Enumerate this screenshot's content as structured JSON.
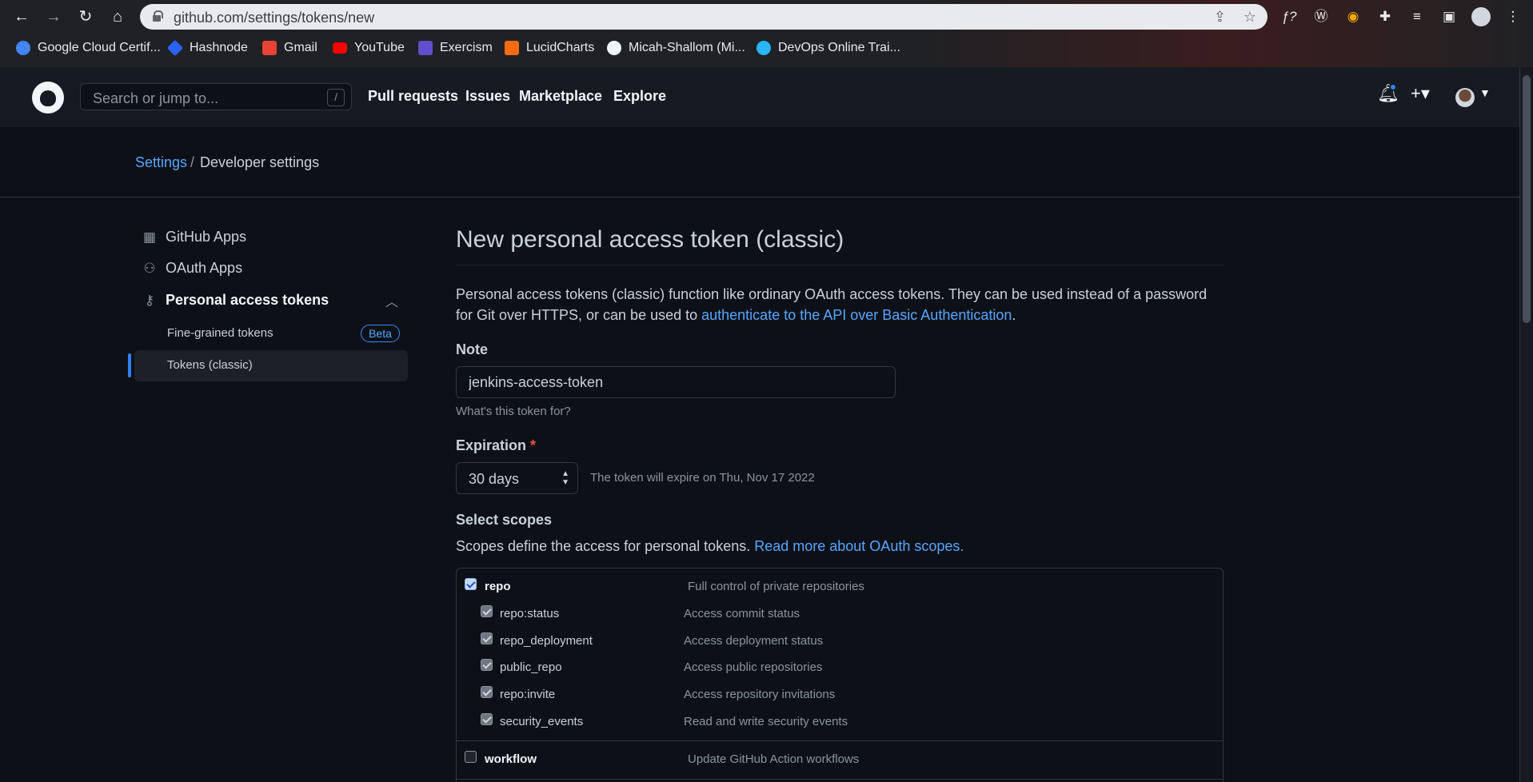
{
  "browser": {
    "url": "github.com/settings/tokens/new",
    "bookmarks": [
      {
        "label": "Google Cloud Certif...",
        "color": "#4285f4"
      },
      {
        "label": "Hashnode",
        "color": "#2962ff"
      },
      {
        "label": "Gmail",
        "color": "#ea4335"
      },
      {
        "label": "YouTube",
        "color": "#ff0000"
      },
      {
        "label": "Exercism",
        "color": "#604fcd"
      },
      {
        "label": "LucidCharts",
        "color": "#f96b13"
      },
      {
        "label": "Micah-Shallom (Mi...",
        "color": "#f0f6fc"
      },
      {
        "label": "DevOps Online Trai...",
        "color": "#29b6f6"
      }
    ]
  },
  "header": {
    "search_placeholder": "Search or jump to...",
    "search_shortcut": "/",
    "nav": [
      "Pull requests",
      "Issues",
      "Marketplace",
      "Explore"
    ]
  },
  "breadcrumb": {
    "settings": "Settings",
    "separator": "/",
    "current": "Developer settings"
  },
  "sidebar": {
    "github_apps": "GitHub Apps",
    "oauth_apps": "OAuth Apps",
    "personal_tokens": "Personal access tokens",
    "fine_grained": "Fine-grained tokens",
    "beta": "Beta",
    "classic": "Tokens (classic)"
  },
  "main": {
    "title": "New personal access token (classic)",
    "desc_1": "Personal access tokens (classic) function like ordinary OAuth access tokens. They can be used instead of a password for Git over HTTPS, or can be used to ",
    "desc_link": "authenticate to the API over Basic Authentication",
    "desc_end": ".",
    "note_label": "Note",
    "note_value": "jenkins-access-token",
    "note_hint": "What's this token for?",
    "expiration_label": "Expiration",
    "required_mark": "*",
    "expiration_value": "30 days",
    "expiration_text": "The token will expire on Thu, Nov 17 2022",
    "scopes_label": "Select scopes",
    "scopes_desc": "Scopes define the access for personal tokens. ",
    "scopes_link": "Read more about OAuth scopes."
  },
  "scopes": [
    {
      "name": "repo",
      "desc": "Full control of private repositories",
      "checked": true,
      "child": false
    },
    {
      "name": "repo:status",
      "desc": "Access commit status",
      "checked": true,
      "child": true
    },
    {
      "name": "repo_deployment",
      "desc": "Access deployment status",
      "checked": true,
      "child": true
    },
    {
      "name": "public_repo",
      "desc": "Access public repositories",
      "checked": true,
      "child": true
    },
    {
      "name": "repo:invite",
      "desc": "Access repository invitations",
      "checked": true,
      "child": true
    },
    {
      "name": "security_events",
      "desc": "Read and write security events",
      "checked": true,
      "child": true
    },
    {
      "name": "workflow",
      "desc": "Update GitHub Action workflows",
      "checked": false,
      "child": false
    }
  ]
}
